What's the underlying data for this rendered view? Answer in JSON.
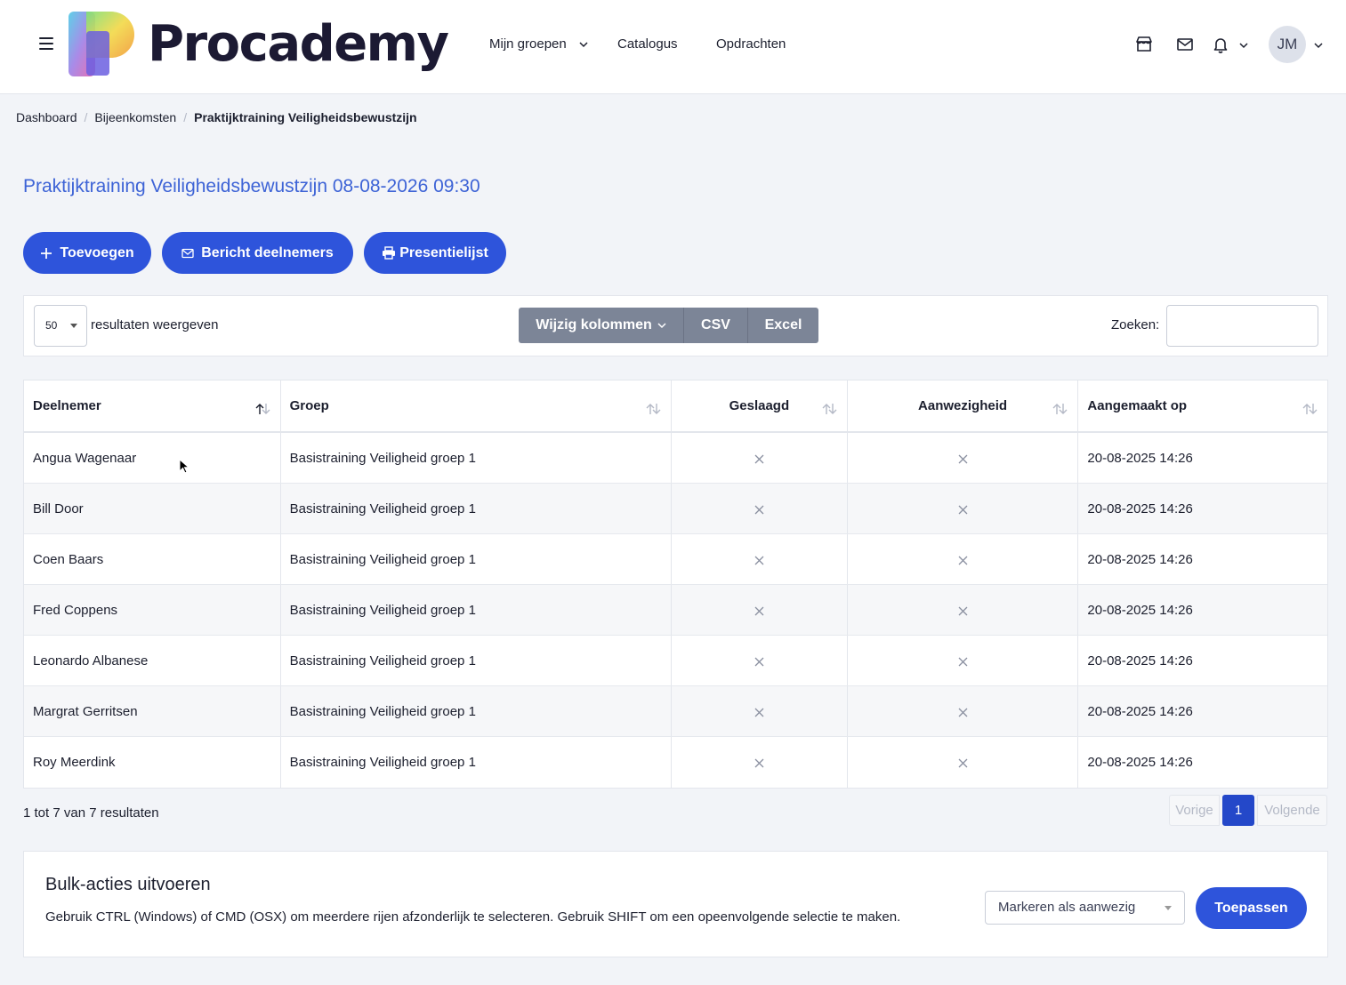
{
  "brand": {
    "name": "Procademy"
  },
  "nav": {
    "groups_label": "Mijn groepen",
    "catalog_label": "Catalogus",
    "assignments_label": "Opdrachten",
    "avatar_initials": "JM",
    "icons": [
      "store-icon",
      "mail-icon",
      "bell-icon"
    ]
  },
  "breadcrumb": {
    "items": [
      "Dashboard",
      "Bijeenkomsten",
      "Praktijktraining Veiligheidsbewustzijn"
    ]
  },
  "page": {
    "title": "Praktijktraining Veiligheidsbewustzijn 08-08-2026 09:30"
  },
  "actions": {
    "add_label": "Toevoegen",
    "message_label": "Bericht deelnemers",
    "attendance_label": "Presentielijst"
  },
  "toolbar": {
    "length_value": "50",
    "length_label": "resultaten weergeven",
    "columns_label": "Wijzig kolommen",
    "csv_label": "CSV",
    "excel_label": "Excel",
    "search_label": "Zoeken:",
    "search_value": ""
  },
  "table": {
    "headers": [
      "Deelnemer",
      "Groep",
      "Geslaagd",
      "Aanwezigheid",
      "Aangemaakt op"
    ],
    "rows": [
      {
        "name": "Angua Wagenaar",
        "group": "Basistraining Veiligheid groep 1",
        "created": "20-08-2025 14:26"
      },
      {
        "name": "Bill Door",
        "group": "Basistraining Veiligheid groep 1",
        "created": "20-08-2025 14:26"
      },
      {
        "name": "Coen Baars",
        "group": "Basistraining Veiligheid groep 1",
        "created": "20-08-2025 14:26"
      },
      {
        "name": "Fred Coppens",
        "group": "Basistraining Veiligheid groep 1",
        "created": "20-08-2025 14:26"
      },
      {
        "name": "Leonardo Albanese",
        "group": "Basistraining Veiligheid groep 1",
        "created": "20-08-2025 14:26"
      },
      {
        "name": "Margrat Gerritsen",
        "group": "Basistraining Veiligheid groep 1",
        "created": "20-08-2025 14:26"
      },
      {
        "name": "Roy Meerdink",
        "group": "Basistraining Veiligheid groep 1",
        "created": "20-08-2025 14:26"
      }
    ]
  },
  "pagination": {
    "info": "1 tot 7 van 7 resultaten",
    "prev_label": "Vorige",
    "current_page": "1",
    "next_label": "Volgende"
  },
  "bulk": {
    "title": "Bulk-acties uitvoeren",
    "description": "Gebruik CTRL (Windows) of CMD (OSX) om meerdere rijen afzonderlijk te selecteren. Gebruik SHIFT om een opeenvolgende selectie te maken.",
    "selected_action": "Markeren als aanwezig",
    "apply_label": "Toepassen"
  },
  "colors": {
    "primary": "#2e54db",
    "title_blue": "#3d63d6",
    "grey_button": "#7c8597",
    "page_bg": "#f2f4f8"
  }
}
